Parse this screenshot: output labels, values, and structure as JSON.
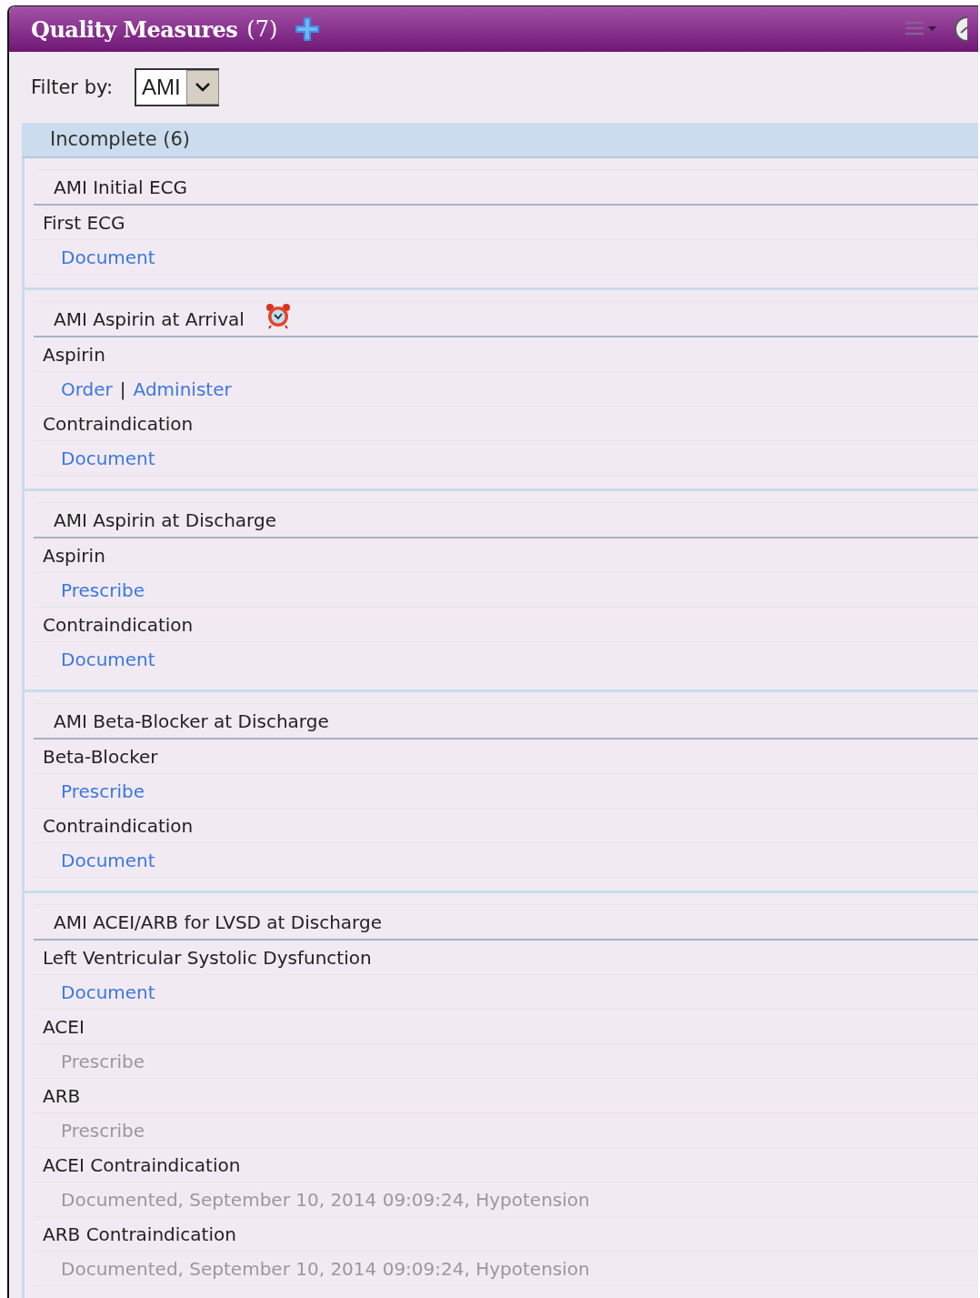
{
  "panel": {
    "title": "Quality Measures",
    "count": "(7)"
  },
  "filter": {
    "label": "Filter by:",
    "value": "AMI"
  },
  "group": {
    "title": "Incomplete (6)",
    "expanded": true
  },
  "measures": [
    {
      "title": "AMI Initial ECG",
      "alarm": false,
      "rows": [
        {
          "kind": "label",
          "text": "First ECG"
        },
        {
          "kind": "actions",
          "actions": [
            {
              "label": "Document",
              "disabled": false
            }
          ]
        }
      ]
    },
    {
      "title": "AMI Aspirin at Arrival",
      "alarm": true,
      "rows": [
        {
          "kind": "label",
          "text": "Aspirin"
        },
        {
          "kind": "actions",
          "separator": "|",
          "actions": [
            {
              "label": "Order",
              "disabled": false
            },
            {
              "label": "Administer",
              "disabled": false
            }
          ]
        },
        {
          "kind": "label",
          "text": "Contraindication"
        },
        {
          "kind": "actions",
          "actions": [
            {
              "label": "Document",
              "disabled": false
            }
          ]
        }
      ]
    },
    {
      "title": "AMI Aspirin at Discharge",
      "alarm": false,
      "rows": [
        {
          "kind": "label",
          "text": "Aspirin"
        },
        {
          "kind": "actions",
          "actions": [
            {
              "label": "Prescribe",
              "disabled": false
            }
          ]
        },
        {
          "kind": "label",
          "text": "Contraindication"
        },
        {
          "kind": "actions",
          "actions": [
            {
              "label": "Document",
              "disabled": false
            }
          ]
        }
      ]
    },
    {
      "title": "AMI Beta-Blocker at Discharge",
      "alarm": false,
      "rows": [
        {
          "kind": "label",
          "text": "Beta-Blocker"
        },
        {
          "kind": "actions",
          "actions": [
            {
              "label": "Prescribe",
              "disabled": false
            }
          ]
        },
        {
          "kind": "label",
          "text": "Contraindication"
        },
        {
          "kind": "actions",
          "actions": [
            {
              "label": "Document",
              "disabled": false
            }
          ]
        }
      ]
    },
    {
      "title": "AMI ACEI/ARB for LVSD at Discharge",
      "alarm": false,
      "rows": [
        {
          "kind": "label",
          "text": "Left Ventricular Systolic Dysfunction"
        },
        {
          "kind": "actions",
          "actions": [
            {
              "label": "Document",
              "disabled": false
            }
          ]
        },
        {
          "kind": "label",
          "text": "ACEI"
        },
        {
          "kind": "actions",
          "actions": [
            {
              "label": "Prescribe",
              "disabled": true
            }
          ]
        },
        {
          "kind": "label",
          "text": "ARB"
        },
        {
          "kind": "actions",
          "actions": [
            {
              "label": "Prescribe",
              "disabled": true
            }
          ]
        },
        {
          "kind": "label",
          "text": "ACEI Contraindication"
        },
        {
          "kind": "note",
          "text": "Documented, September 10, 2014 09:09:24, Hypotension"
        },
        {
          "kind": "label",
          "text": "ARB Contraindication"
        },
        {
          "kind": "note",
          "text": "Documented, September 10, 2014 09:09:24, Hypotension"
        }
      ]
    }
  ]
}
